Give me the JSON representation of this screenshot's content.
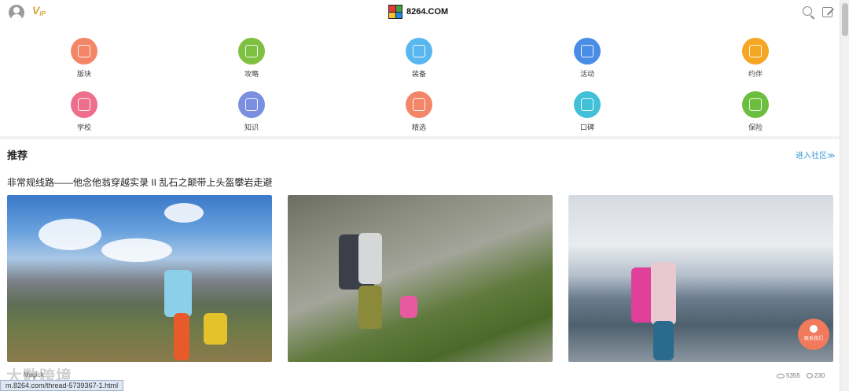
{
  "header": {
    "vip_label": "V",
    "vip_sub": "IP",
    "logo_text": "8264.COM",
    "icons": [
      "avatar-icon",
      "vip-icon",
      "search-icon",
      "edit-icon"
    ]
  },
  "nav": {
    "items": [
      {
        "label": "版块",
        "color": "#f48668"
      },
      {
        "label": "攻略",
        "color": "#7dc042"
      },
      {
        "label": "装备",
        "color": "#59b7f0"
      },
      {
        "label": "活动",
        "color": "#4a8de6"
      },
      {
        "label": "约伴",
        "color": "#f5a623"
      },
      {
        "label": "学校",
        "color": "#ee6f8c"
      },
      {
        "label": "知识",
        "color": "#7b8fe0"
      },
      {
        "label": "精选",
        "color": "#f48668"
      },
      {
        "label": "口碑",
        "color": "#41c0d8"
      },
      {
        "label": "保险",
        "color": "#6cbf3e"
      }
    ]
  },
  "recommend": {
    "title": "推荐",
    "enter_link": "进入社区≫",
    "thread_title": "非常规线路——他念他翁穿越实录 II 乱石之颠带上头盔攀岩走避",
    "author": "Magick",
    "views": "5355",
    "comments": "230"
  },
  "fab": {
    "label": "联系我们"
  },
  "watermark": "大数跨境",
  "status_url": "m.8264.com/thread-5739367-1.html"
}
